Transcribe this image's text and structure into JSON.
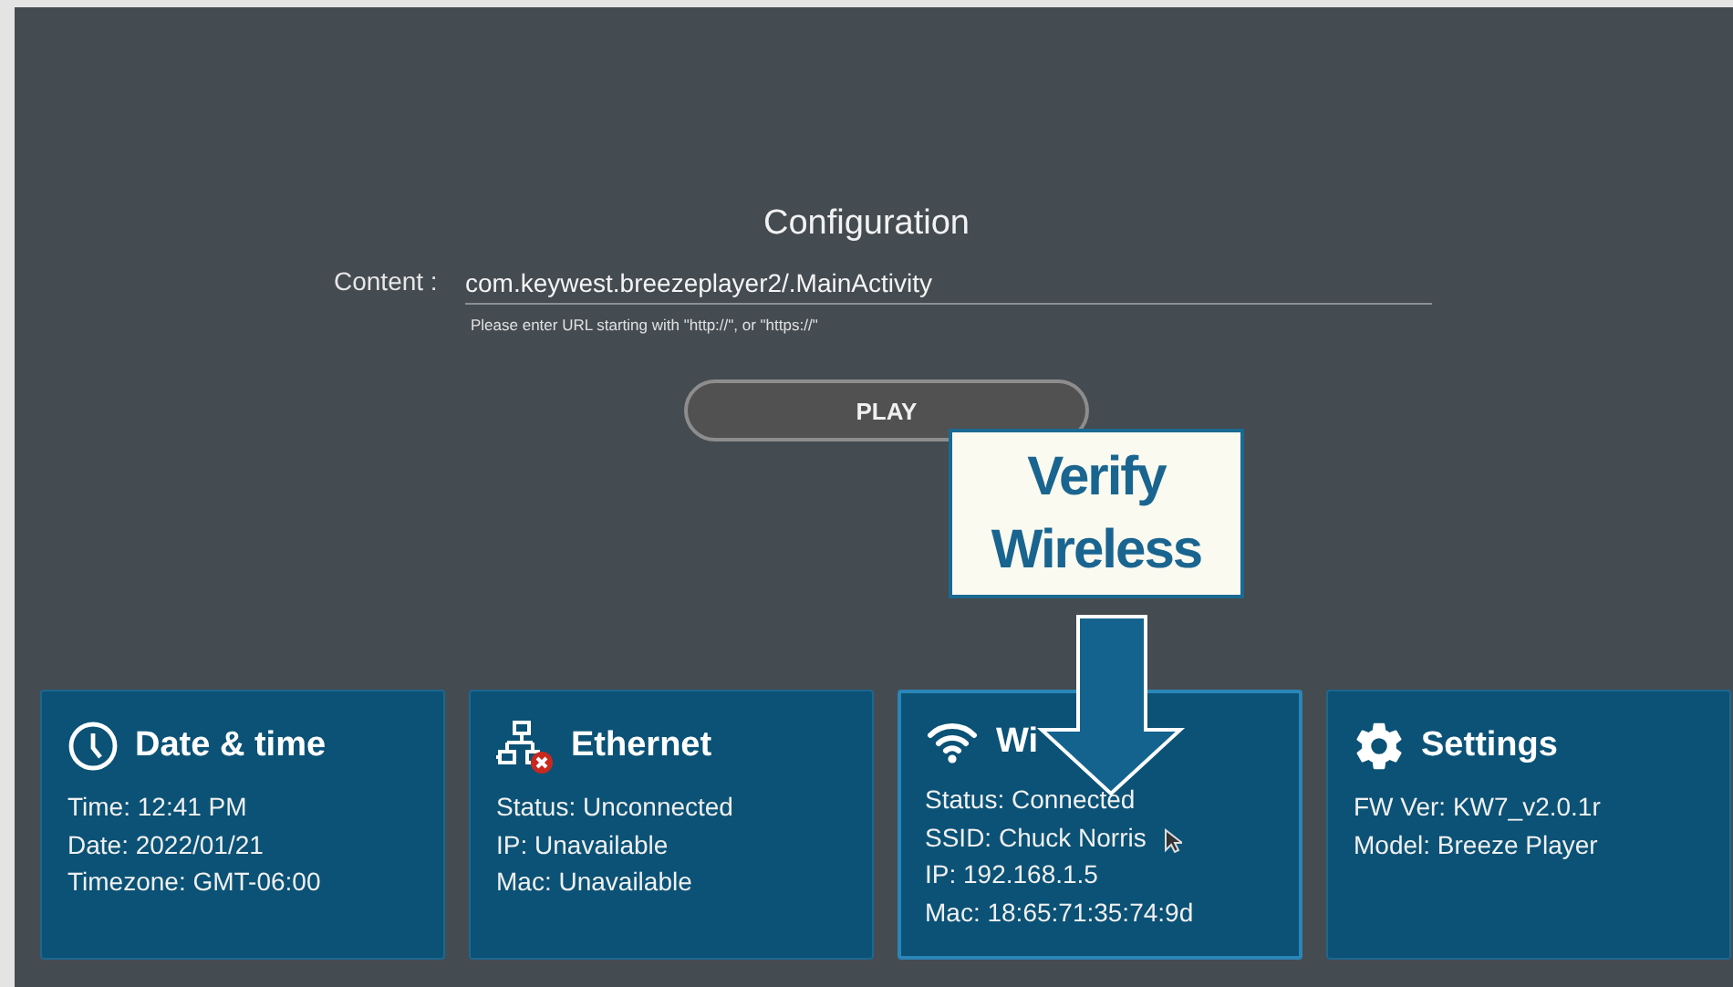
{
  "title": "Configuration",
  "content_field": {
    "label": "Content :",
    "value": "com.keywest.breezeplayer2/.MainActivity",
    "hint": "Please enter URL starting with \"http://\", or \"https://\""
  },
  "play_button": "PLAY",
  "callout": {
    "text": "Verify Wireless"
  },
  "cards": [
    {
      "kind": "clock",
      "title": "Date & time",
      "selected": false,
      "lines": [
        "Time: 12:41 PM",
        "Date: 2022/01/21",
        "Timezone: GMT-06:00"
      ]
    },
    {
      "kind": "network",
      "title": "Ethernet",
      "selected": false,
      "lines": [
        "Status: Unconnected",
        "IP: Unavailable",
        "Mac: Unavailable"
      ]
    },
    {
      "kind": "wifi",
      "title": "Wi",
      "selected": true,
      "lines": [
        "Status: Connected",
        "SSID: Chuck Norris",
        "IP: 192.168.1.5",
        "Mac: 18:65:71:35:74:9d"
      ]
    },
    {
      "kind": "settings",
      "title": "Settings",
      "selected": false,
      "lines": [
        "FW Ver: KW7_v2.0.1r",
        "Model: Breeze Player"
      ]
    }
  ]
}
